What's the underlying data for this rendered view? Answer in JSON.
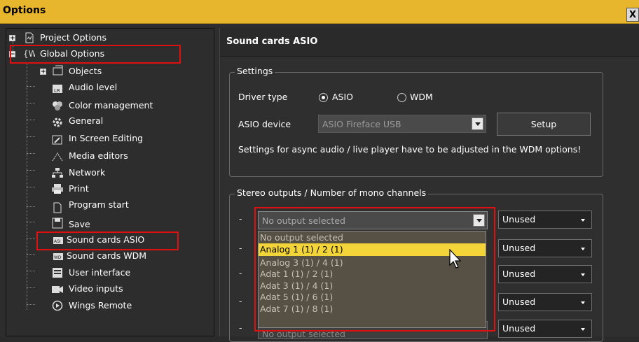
{
  "window": {
    "title": "Options",
    "close_label": "X"
  },
  "tree": {
    "items": [
      {
        "label": "Project Options",
        "icon": "document-icon",
        "expander": "+"
      },
      {
        "label": "Global Options",
        "icon": "global-w-icon",
        "expander": "−"
      },
      {
        "label": "Objects",
        "icon": "objects-icon",
        "expander": "+"
      },
      {
        "label": "Audio level",
        "icon": "audio-level-icon"
      },
      {
        "label": "Color management",
        "icon": "color-management-icon"
      },
      {
        "label": "General",
        "icon": "gear-icon"
      },
      {
        "label": "In Screen Editing",
        "icon": "in-screen-edit-icon"
      },
      {
        "label": "Media editors",
        "icon": "media-editors-icon"
      },
      {
        "label": "Network",
        "icon": "network-icon"
      },
      {
        "label": "Print",
        "icon": "printer-icon"
      },
      {
        "label": "Program start",
        "icon": "program-start-icon"
      },
      {
        "label": "Save",
        "icon": "save-icon"
      },
      {
        "label": "Sound cards ASIO",
        "icon": "asio-icon"
      },
      {
        "label": "Sound cards WDM",
        "icon": "wdm-icon"
      },
      {
        "label": "User interface",
        "icon": "user-interface-icon"
      },
      {
        "label": "Video inputs",
        "icon": "video-camera-icon"
      },
      {
        "label": "Wings Remote",
        "icon": "play-circle-icon"
      }
    ]
  },
  "panel": {
    "title": "Sound cards ASIO",
    "settings": {
      "group_label": "Settings",
      "driver_type_label": "Driver type",
      "radio_asio": "ASIO",
      "radio_wdm": "WDM",
      "selected_driver": "ASIO",
      "asio_device_label": "ASIO device",
      "asio_device_value": "ASIO Fireface USB",
      "setup_button": "Setup",
      "note": "Settings for async audio / live player have to be adjusted in the WDM options!"
    },
    "stereo": {
      "group_label": "Stereo outputs / Number of mono channels",
      "dash": "-",
      "first_output_value": "No output selected",
      "last_output_partial": "No output selected",
      "mono_values": [
        "Unused",
        "Unused",
        "Unused",
        "Unused",
        "Unused"
      ]
    }
  },
  "dropdown": {
    "options": [
      "No output selected",
      "Analog 1 (1) / 2 (1)",
      "Analog 3 (1) / 4 (1)",
      "Adat 1 (1) / 2 (1)",
      "Adat 3 (1) / 4 (1)",
      "Adat 5 (1) / 6 (1)",
      "Adat 7 (1) / 8 (1)"
    ],
    "highlighted": "Analog 1 (1) / 2 (1)"
  },
  "colors": {
    "titlebar": "#e8b62d",
    "highlight_border": "#e01010",
    "dropdown_selected": "#f3d53a"
  }
}
